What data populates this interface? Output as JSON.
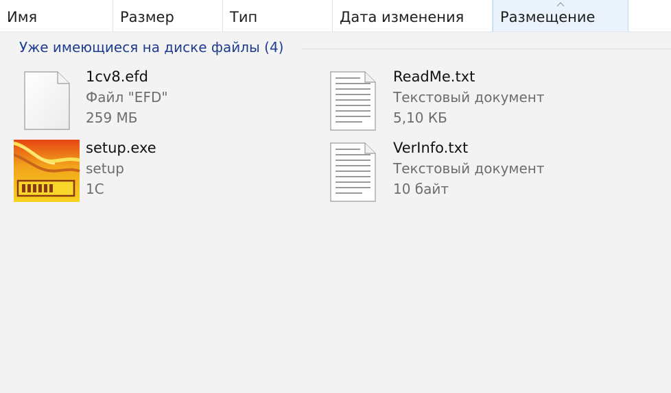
{
  "columns": {
    "name": "Имя",
    "size": "Размер",
    "type": "Тип",
    "date": "Дата изменения",
    "location": "Размещение"
  },
  "sort": {
    "column": "location",
    "direction": "ascending"
  },
  "group": {
    "label": "Уже имеющиеся на диске файлы (4)"
  },
  "files": [
    {
      "name": "1cv8.efd",
      "type": "Файл \"EFD\"",
      "size": "259 МБ",
      "icon": "generic-file-icon"
    },
    {
      "name": "ReadMe.txt",
      "type": "Текстовый документ",
      "size": "5,10 КБ",
      "icon": "text-document-icon"
    },
    {
      "name": "setup.exe",
      "type": "setup",
      "size": "1С",
      "icon": "setup-1c-icon"
    },
    {
      "name": "VerInfo.txt",
      "type": "Текстовый документ",
      "size": "10 байт",
      "icon": "text-document-icon"
    }
  ],
  "colors": {
    "background": "#f3f3f3",
    "group_text": "#1e3d8f",
    "secondary_text": "#6d6d6d",
    "sorted_column": "#eaf3fb"
  }
}
